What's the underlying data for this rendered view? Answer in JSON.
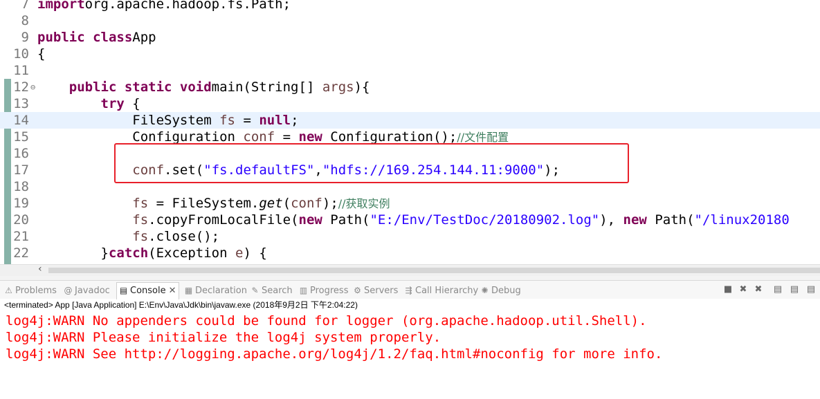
{
  "editor": {
    "lines": [
      {
        "num": "7",
        "code": [
          [
            "kw",
            "import"
          ],
          [
            "",
            "org.apache.hadoop.fs.Path;"
          ]
        ]
      },
      {
        "num": "8",
        "code": []
      },
      {
        "num": "9",
        "code": [
          [
            "kw",
            "public class"
          ],
          [
            "",
            "App"
          ]
        ]
      },
      {
        "num": "10",
        "code": [
          [
            "",
            "{"
          ]
        ]
      },
      {
        "num": "11",
        "code": []
      },
      {
        "num": "12",
        "fold": "⊖",
        "code": [
          [
            "",
            "    "
          ],
          [
            "kw",
            "public static void"
          ],
          [
            "",
            "main(String[] "
          ],
          [
            "var",
            "args"
          ],
          [
            "",
            "){"
          ]
        ]
      },
      {
        "num": "13",
        "code": [
          [
            "",
            "        "
          ],
          [
            "kw",
            "try"
          ],
          [
            "",
            " {"
          ]
        ]
      },
      {
        "num": "14",
        "current": true,
        "code": [
          [
            "",
            "            FileSystem "
          ],
          [
            "var",
            "fs"
          ],
          [
            "",
            " = "
          ],
          [
            "kw",
            "null"
          ],
          [
            "",
            ";"
          ]
        ]
      },
      {
        "num": "15",
        "code": [
          [
            "",
            "            Configuration "
          ],
          [
            "var",
            "conf"
          ],
          [
            "",
            " = "
          ],
          [
            "kw",
            "new"
          ],
          [
            "",
            " Configuration();"
          ],
          [
            "cmt",
            "//文件配置"
          ]
        ]
      },
      {
        "num": "16",
        "code": []
      },
      {
        "num": "17",
        "code": [
          [
            "",
            "            "
          ],
          [
            "var",
            "conf"
          ],
          [
            "",
            ".set("
          ],
          [
            "str",
            "\"fs.defaultFS\""
          ],
          [
            "",
            ","
          ],
          [
            "str",
            "\"hdfs://169.254.144.11:9000\""
          ],
          [
            "",
            ");"
          ]
        ]
      },
      {
        "num": "18",
        "code": []
      },
      {
        "num": "19",
        "code": [
          [
            "",
            "            "
          ],
          [
            "var",
            "fs"
          ],
          [
            "",
            " = FileSystem."
          ],
          [
            "it",
            "get"
          ],
          [
            "",
            "("
          ],
          [
            "var",
            "conf"
          ],
          [
            "",
            ");"
          ],
          [
            "cmt",
            "//获取实例"
          ]
        ]
      },
      {
        "num": "20",
        "code": [
          [
            "",
            "            "
          ],
          [
            "var",
            "fs"
          ],
          [
            "",
            ".copyFromLocalFile("
          ],
          [
            "kw",
            "new"
          ],
          [
            "",
            " Path("
          ],
          [
            "str",
            "\"E:/Env/TestDoc/20180902.log\""
          ],
          [
            "",
            "), "
          ],
          [
            "kw",
            "new"
          ],
          [
            "",
            " Path("
          ],
          [
            "str",
            "\"/linux20180"
          ]
        ]
      },
      {
        "num": "21",
        "code": [
          [
            "",
            "            "
          ],
          [
            "var",
            "fs"
          ],
          [
            "",
            ".close();"
          ]
        ]
      },
      {
        "num": "22",
        "code": [
          [
            "",
            "        }"
          ],
          [
            "kw",
            "catch"
          ],
          [
            "",
            "(Exception "
          ],
          [
            "var",
            "e"
          ],
          [
            "",
            ") {"
          ]
        ]
      }
    ]
  },
  "panel": {
    "tabs": [
      {
        "label": "Problems",
        "icon": "⚠",
        "active": false
      },
      {
        "label": "Javadoc",
        "icon": "@",
        "active": false
      },
      {
        "label": "Console",
        "icon": "▤",
        "active": true,
        "close": "✕"
      },
      {
        "label": "Declaration",
        "icon": "▦",
        "active": false
      },
      {
        "label": "Search",
        "icon": "✎",
        "active": false
      },
      {
        "label": "Progress",
        "icon": "▥",
        "active": false
      },
      {
        "label": "Servers",
        "icon": "⚙",
        "active": false
      },
      {
        "label": "Call Hierarchy",
        "icon": "⇶",
        "active": false
      },
      {
        "label": "Debug",
        "icon": "✺",
        "active": false
      }
    ],
    "toolbar_icons": [
      "■",
      "✖",
      "✖",
      "▤",
      "▤",
      "▤"
    ],
    "status": "<terminated> App [Java Application] E:\\Env\\Java\\Jdk\\bin\\javaw.exe (2018年9月2日 下午2:04:22)",
    "output": [
      "log4j:WARN No appenders could be found for logger (org.apache.hadoop.util.Shell).",
      "log4j:WARN Please initialize the log4j system properly.",
      "log4j:WARN See http://logging.apache.org/log4j/1.2/faq.html#noconfig for more info."
    ]
  },
  "colors": {
    "keyword": "#7f0055",
    "string": "#2a00ff",
    "comment": "#3f7f5f",
    "variable": "#6a3e3e",
    "console_error": "#ff0000",
    "highlight_box": "#e8202a"
  }
}
